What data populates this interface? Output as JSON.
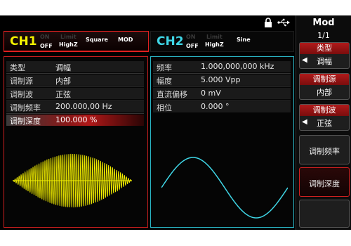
{
  "channel1": {
    "name": "CH1",
    "state_top": "ON",
    "state": "OFF",
    "limit": "Limit",
    "load": "HighZ",
    "waveform": "Square",
    "mode": "MOD"
  },
  "channel2": {
    "name": "CH2",
    "state_top": "ON",
    "state": "OFF",
    "limit": "Limit",
    "load": "HighZ",
    "waveform": "Sine"
  },
  "ch1_params": [
    {
      "label": "类型",
      "value": "调幅"
    },
    {
      "label": "调制源",
      "value": "内部"
    },
    {
      "label": "调制波",
      "value": "正弦"
    },
    {
      "label": "调制频率",
      "value": "200.000,00 Hz"
    },
    {
      "label": "调制深度",
      "value": "100.000 %"
    }
  ],
  "ch2_params": [
    {
      "label": "频率",
      "value": "1.000,000,000 kHz"
    },
    {
      "label": "幅度",
      "value": "5.000 Vpp"
    },
    {
      "label": "直流偏移",
      "value": "0 mV"
    },
    {
      "label": "相位",
      "value": "0.000 °"
    }
  ],
  "menu": {
    "title": "Mod",
    "page": "1/1",
    "items": [
      {
        "header": "类型",
        "value": "调幅"
      },
      {
        "header": "调制源",
        "value": "内部"
      },
      {
        "header": "调制波",
        "value": "正弦"
      },
      {
        "label": "调制频率"
      },
      {
        "label": "调制深度"
      },
      {
        "label": ""
      }
    ]
  },
  "colors": {
    "ch1": "#f4f000",
    "ch2": "#3fd6e6",
    "accent_red": "#c81f1f",
    "background": "#000000"
  },
  "icons": [
    "lock-icon",
    "usb-icon"
  ]
}
